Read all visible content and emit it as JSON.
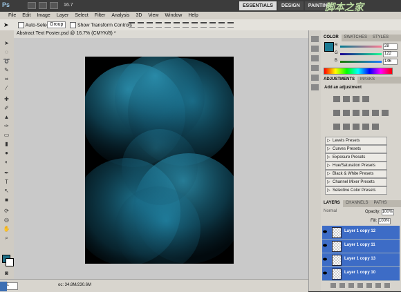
{
  "app": {
    "logo": "Ps",
    "zoom": "16.7",
    "workspaces": [
      "ESSENTIALS",
      "DESIGN",
      "PAINTING"
    ],
    "active_workspace": "ESSENTIALS",
    "watermark": "脚本之家"
  },
  "menu": [
    "File",
    "Edit",
    "Image",
    "Layer",
    "Select",
    "Filter",
    "Analysis",
    "3D",
    "View",
    "Window",
    "Help"
  ],
  "options": {
    "auto_select_label": "Auto-Select:",
    "group_value": "Group",
    "transform_label": "Show Transform Controls"
  },
  "document": {
    "tab_title": "Abstract Text Poster.psd @ 16.7% (CMYK/8) *",
    "status_zoom": "16.",
    "status_doc": "oc: 34.8M/230.6M",
    "status_btn": "ab..."
  },
  "colors": {
    "accent": "#1b7a92",
    "layer_selected": "#3d6cc6",
    "canvas_bg": "#c9c9c9"
  },
  "color_panel": {
    "tabs": [
      "COLOR",
      "SWATCHES",
      "STYLES"
    ],
    "r": "28",
    "g": "122",
    "b": "146",
    "r_label": "R",
    "g_label": "G",
    "b_label": "B"
  },
  "adjustments": {
    "tabs": [
      "ADJUSTMENTS",
      "MASKS"
    ],
    "title": "Add an adjustment",
    "presets": [
      "Levels Presets",
      "Curves Presets",
      "Exposure Presets",
      "Hue/Saturation Presets",
      "Black & White Presets",
      "Channel Mixer Presets",
      "Selective Color Presets"
    ]
  },
  "layers": {
    "tabs": [
      "LAYERS",
      "CHANNELS",
      "PATHS"
    ],
    "blend_mode": "Normal",
    "opacity_label": "Opacity:",
    "opacity": "100%",
    "fill_label": "Fill:",
    "fill": "100%",
    "items": [
      "Layer 1 copy 12",
      "Layer 1 copy 11",
      "Layer 1 copy 13",
      "Layer 1 copy 10"
    ]
  }
}
